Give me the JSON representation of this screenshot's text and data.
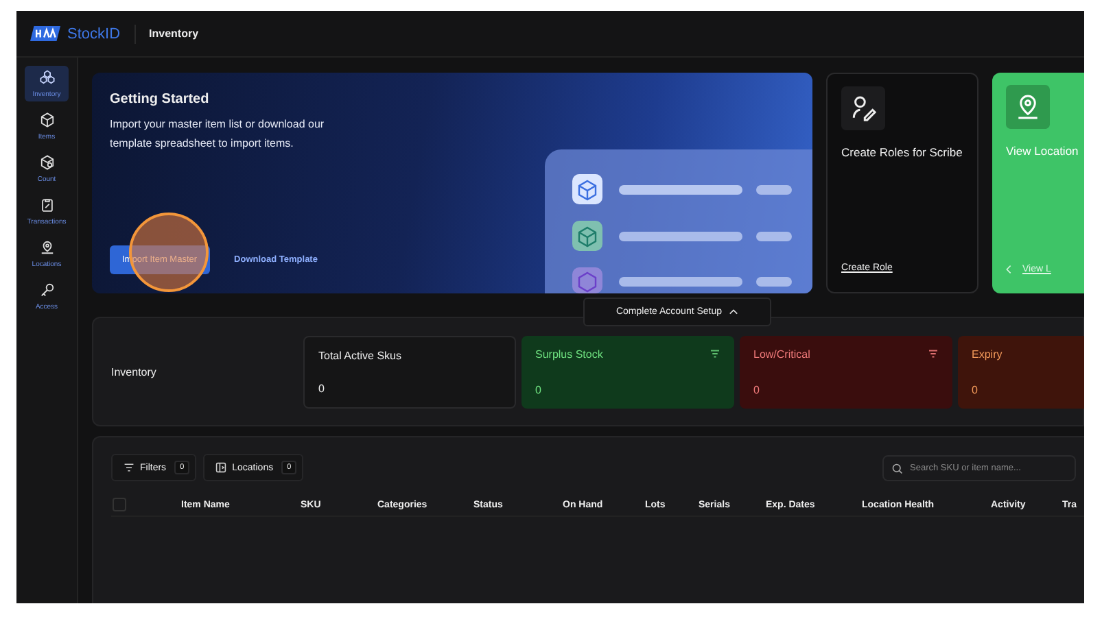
{
  "header": {
    "brand": "StockID",
    "page_title": "Inventory"
  },
  "sidebar": {
    "items": [
      {
        "label": "Inventory",
        "selected": true
      },
      {
        "label": "Items",
        "selected": false
      },
      {
        "label": "Count",
        "selected": false
      },
      {
        "label": "Transactions",
        "selected": false
      },
      {
        "label": "Locations",
        "selected": false
      },
      {
        "label": "Access",
        "selected": false
      }
    ]
  },
  "getting_started": {
    "title": "Getting Started",
    "description": "Import your master item list or download our template spreadsheet to import items.",
    "primary_button": "Import Item Master",
    "secondary_button": "Download Template"
  },
  "setup_cards": [
    {
      "kind": "dark",
      "title": "Create Roles for Scribe",
      "link": "Create Role"
    },
    {
      "kind": "green",
      "title": "View Location",
      "link": "View L"
    }
  ],
  "setup_toggle": {
    "label": "Complete Account Setup",
    "expanded": true
  },
  "summary": {
    "label": "Inventory",
    "cards": [
      {
        "kind": "neutral",
        "title": "Total Active Skus",
        "value": "0",
        "filter": false
      },
      {
        "kind": "surplus",
        "title": "Surplus Stock",
        "value": "0",
        "filter": true
      },
      {
        "kind": "low",
        "title": "Low/Critical",
        "value": "0",
        "filter": true
      },
      {
        "kind": "expiry",
        "title": "Expiry",
        "value": "0"
      }
    ]
  },
  "toolbar": {
    "filters": {
      "label": "Filters",
      "count": "0"
    },
    "locations": {
      "label": "Locations",
      "count": "0"
    },
    "search": {
      "placeholder": "Search SKU or item name..."
    }
  },
  "table": {
    "select_all": {
      "checked": false
    },
    "columns": [
      "Item Name",
      "SKU",
      "Categories",
      "Status",
      "On Hand",
      "Lots",
      "Serials",
      "Exp. Dates",
      "Location Health",
      "Activity",
      "Tra"
    ]
  },
  "click_marker": true
}
